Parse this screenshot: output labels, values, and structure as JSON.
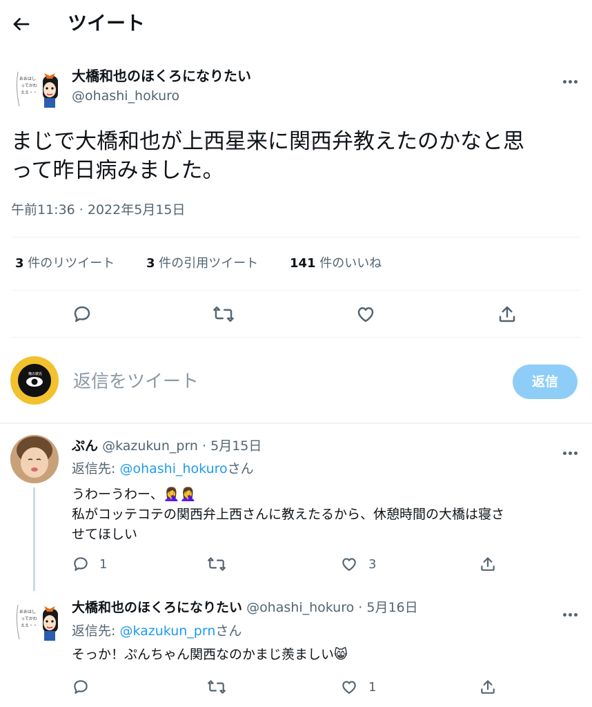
{
  "header": {
    "title": "ツイート"
  },
  "main_tweet": {
    "author_name": "大橋和也のほくろになりたい",
    "author_handle": "@ohashi_hokuro",
    "avatar_text": "おおはしってかわええ",
    "text_line1": "まじで大橋和也が上西星来に関西弁教えたのかなと思",
    "text_line2": "って昨日病みました。",
    "timestamp": "午前11:36 · 2022年5月15日",
    "stats": {
      "retweets_count": "3",
      "retweets_label": " 件のリツイート",
      "quotes_count": "3",
      "quotes_label": " 件の引用ツイート",
      "likes_count": "141",
      "likes_label": " 件のいいね"
    }
  },
  "compose": {
    "placeholder": "返信をツイート",
    "button_label": "返信",
    "avatar_text": "俺の彼氏"
  },
  "replies": [
    {
      "author_name": "ぷん",
      "author_handle": "@kazukun_prn",
      "date": " · 5月15日",
      "reply_prefix": "返信先: ",
      "reply_to": "@ohashi_hokuro",
      "reply_suffix": "さん",
      "text_line1": "うわーうわー、",
      "text_emoji1": "🤦‍♀️🤦‍♀️",
      "text_line2": "私がコッテコテの関西弁上西さんに教えたるから、休憩時間の大橋は寝さ",
      "text_line3": "せてほしい",
      "reply_count": "1",
      "retweet_count": "",
      "like_count": "3"
    },
    {
      "author_name": "大橋和也のほくろになりたい",
      "author_handle": "@ohashi_hokuro",
      "date": " · 5月16日",
      "reply_prefix": "返信先: ",
      "reply_to": "@kazukun_prn",
      "reply_suffix": "さん",
      "text_line1": "そっか！ぷんちゃん関西なのかまじ羨ましい",
      "text_emoji1": "😸",
      "reply_count": "",
      "retweet_count": "",
      "like_count": "1"
    }
  ],
  "colors": {
    "accent": "#1d9bf0",
    "accent_disabled": "#8ecdf8",
    "text": "#0f1419",
    "muted": "#536471",
    "border": "#eff3f4",
    "compose_avatar_bg": "#f2c12e"
  }
}
